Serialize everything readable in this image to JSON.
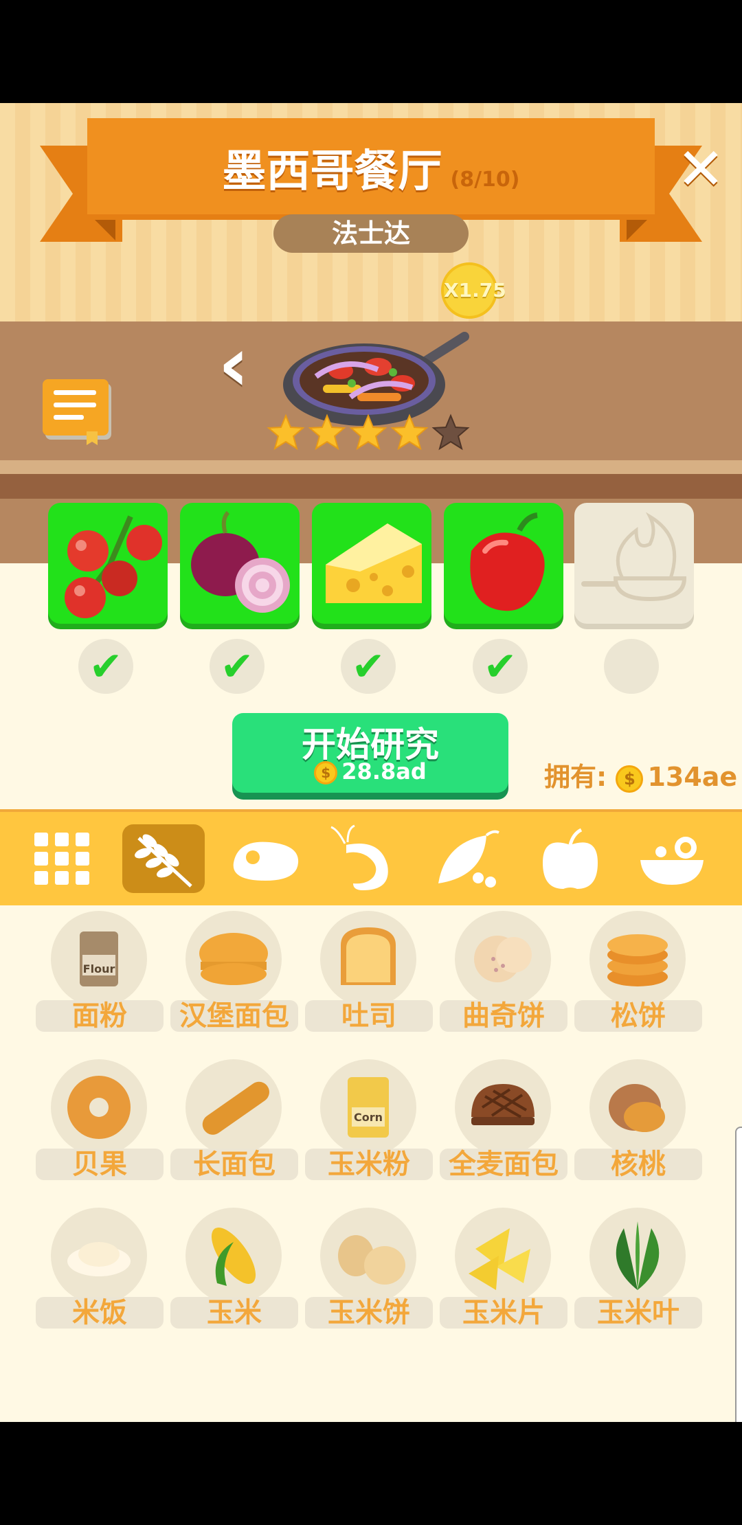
{
  "header": {
    "title": "墨西哥餐厅",
    "progress": "(8/10)",
    "close_symbol": "✕",
    "subtitle": "法士达",
    "multiplier": "X1.75"
  },
  "dish": {
    "name_icon": "fajita-skillet-icon",
    "rating": 4,
    "max_rating": 5,
    "prev_symbol": "‹"
  },
  "ingredients": [
    {
      "icon": "tomato-icon",
      "collected": true
    },
    {
      "icon": "onion-icon",
      "collected": true
    },
    {
      "icon": "cheese-icon",
      "collected": true
    },
    {
      "icon": "red-pepper-icon",
      "collected": true
    },
    {
      "icon": "cooking-pan-icon",
      "collected": false
    }
  ],
  "check_symbol": "✔",
  "research": {
    "label": "开始研究",
    "cost": "28.8ad"
  },
  "owned": {
    "label": "拥有:",
    "value": "134ae"
  },
  "coin_symbol": "$",
  "categories": [
    {
      "icon": "grid-icon",
      "active": false
    },
    {
      "icon": "wheat-icon",
      "active": true
    },
    {
      "icon": "meat-icon",
      "active": false
    },
    {
      "icon": "shrimp-icon",
      "active": false
    },
    {
      "icon": "peas-icon",
      "active": false
    },
    {
      "icon": "apple-icon",
      "active": false
    },
    {
      "icon": "salad-icon",
      "active": false
    }
  ],
  "items": [
    {
      "label": "面粉",
      "icon": "flour-icon",
      "icon_text": "Flour"
    },
    {
      "label": "汉堡面包",
      "icon": "burger-bun-icon"
    },
    {
      "label": "吐司",
      "icon": "toast-icon"
    },
    {
      "label": "曲奇饼",
      "icon": "cookie-icon"
    },
    {
      "label": "松饼",
      "icon": "pancake-icon"
    },
    {
      "label": "贝果",
      "icon": "bagel-icon"
    },
    {
      "label": "长面包",
      "icon": "baguette-icon"
    },
    {
      "label": "玉米粉",
      "icon": "cornmeal-icon",
      "icon_text": "Corn"
    },
    {
      "label": "全麦面包",
      "icon": "wholewheat-bread-icon"
    },
    {
      "label": "核桃",
      "icon": "walnut-icon"
    },
    {
      "label": "米饭",
      "icon": "rice-icon"
    },
    {
      "label": "玉米",
      "icon": "corn-icon"
    },
    {
      "label": "玉米饼",
      "icon": "tortilla-icon"
    },
    {
      "label": "玉米片",
      "icon": "nachos-icon"
    },
    {
      "label": "玉米叶",
      "icon": "corn-husk-icon"
    }
  ],
  "colors": {
    "ribbon": "#f0901f",
    "ingredient_done": "#22e11a",
    "research_button": "#29e07a",
    "category_bar": "#ffc63f",
    "item_label": "#f3a73b"
  }
}
